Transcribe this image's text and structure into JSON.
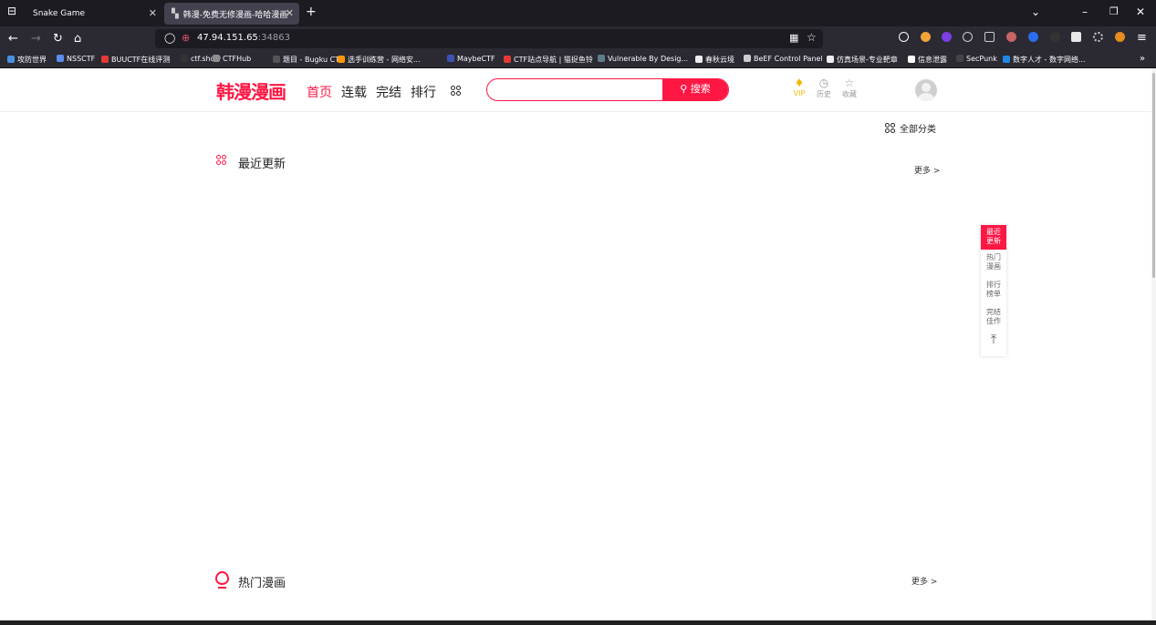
{
  "browser": {
    "tabs": [
      {
        "title": "Snake Game",
        "active": false
      },
      {
        "title": "韩漫-免费无修漫画-哈哈漫画",
        "active": true
      }
    ],
    "new_tab": "+",
    "url_host": "47.94.151.65",
    "url_port": ":34863",
    "bookmarks": [
      {
        "label": "攻防世界",
        "color": "#4a90e2"
      },
      {
        "label": "NSSCTF",
        "color": "#5b8def"
      },
      {
        "label": "BUUCTF在线评测",
        "color": "#e53935"
      },
      {
        "label": "ctf.show",
        "color": "#333333"
      },
      {
        "label": "CTFHub",
        "color": "#8e8e8e"
      },
      {
        "label": "题目 - Bugku CTF",
        "color": "#555555"
      },
      {
        "label": "选手训练营 - 网络安...",
        "color": "#ff9800"
      },
      {
        "label": "MaybeCTF",
        "color": "#3f51b5"
      },
      {
        "label": "CTF站点导航 | 猫捉鱼铃",
        "color": "#e53935"
      },
      {
        "label": "Vulnerable By Desig...",
        "color": "#607d8b"
      },
      {
        "label": "春秋云境",
        "color": "#eeeeee"
      },
      {
        "label": "BeEF Control Panel",
        "color": "#cccccc"
      },
      {
        "label": "仿真场景-专业靶章",
        "color": "#eeeeee"
      },
      {
        "label": "信息泄露",
        "color": "#ffffff"
      },
      {
        "label": "SecPunk",
        "color": "#444444"
      },
      {
        "label": "数字人才 - 数字网络...",
        "color": "#1e88e5"
      }
    ]
  },
  "site": {
    "logo": "韩漫漫画",
    "nav": [
      "首页",
      "连载",
      "完结",
      "排行"
    ],
    "search_button": "搜索",
    "search_placeholder": "",
    "header_icons": [
      {
        "label": "VIP",
        "icon": "diamond-icon",
        "glyph": "♦",
        "color": "#f5b800"
      },
      {
        "label": "历史",
        "icon": "clock-icon",
        "glyph": "◷",
        "color": "#999999"
      },
      {
        "label": "收藏",
        "icon": "star-icon",
        "glyph": "☆",
        "color": "#999999"
      }
    ],
    "all_categories": "全部分类",
    "sections": [
      {
        "title": "最近更新",
        "more": "更多 >"
      },
      {
        "title": "热门漫画",
        "more": "更多 >"
      }
    ],
    "side_nav": [
      "最近\n更新",
      "热门\n漫画",
      "排行\n榜单",
      "完结\n佳作"
    ],
    "accent_color": "#ff1744"
  }
}
